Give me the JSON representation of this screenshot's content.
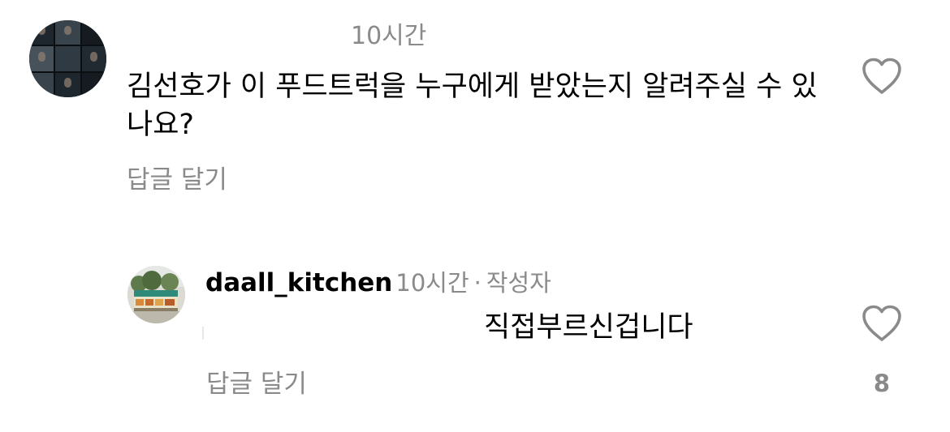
{
  "comments": [
    {
      "time": "10시간",
      "text": "김선호가 이 푸드트럭을 누구에게 받았는지 알려주실 수 있나요?",
      "reply_label": "답글 달기",
      "avatar_icon": "user-avatar-photo-collage",
      "like_icon": "heart-outline-icon"
    }
  ],
  "reply": {
    "username": "daall_kitchen",
    "time": "10시간",
    "separator": "·",
    "author_badge": "작성자",
    "text": "직접부르신겁니다",
    "reply_label": "답글 달기",
    "like_count": "8",
    "avatar_icon": "food-truck-avatar-photo",
    "like_icon": "heart-outline-icon"
  },
  "colors": {
    "text": "#000000",
    "muted": "#8a8a8a",
    "background": "#ffffff"
  }
}
